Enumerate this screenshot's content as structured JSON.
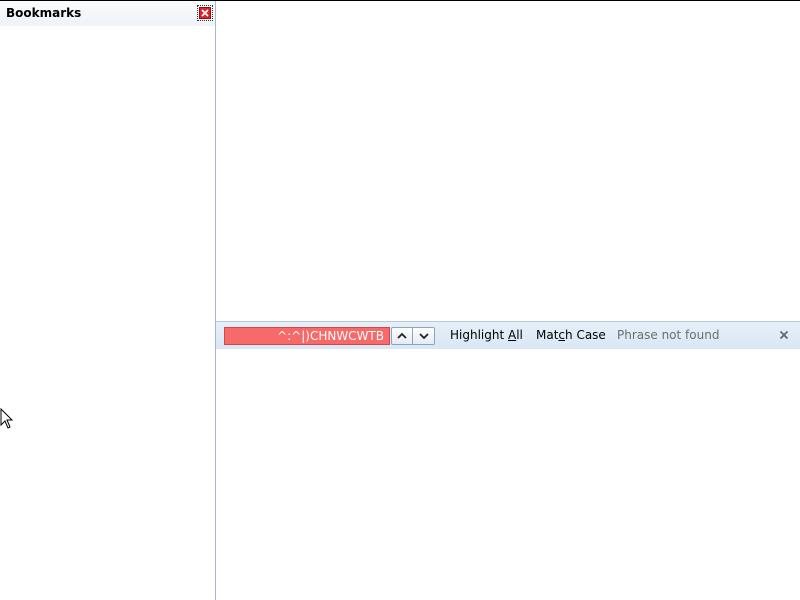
{
  "sidebar": {
    "title": "Bookmarks",
    "close_icon": "close-icon"
  },
  "findbar": {
    "search_value": "^:^|)CHNWCWTB",
    "search_state_color": "#f66a6a",
    "prev_icon": "chevron-up-icon",
    "next_icon": "chevron-down-icon",
    "highlight_all": {
      "before": "Highlight ",
      "accesskey": "A",
      "after": "ll"
    },
    "match_case": {
      "before": "Mat",
      "accesskey": "c",
      "after": "h Case"
    },
    "status": "Phrase not found",
    "close_icon": "close-icon"
  },
  "cursor_icon": "mouse-pointer-icon"
}
